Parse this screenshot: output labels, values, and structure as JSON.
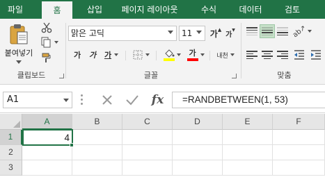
{
  "ribbon_tabs": [
    {
      "label": "파일",
      "active": false
    },
    {
      "label": "홈",
      "active": true
    },
    {
      "label": "삽입",
      "active": false
    },
    {
      "label": "페이지 레이아웃",
      "active": false
    },
    {
      "label": "수식",
      "active": false
    },
    {
      "label": "데이터",
      "active": false
    },
    {
      "label": "검토",
      "active": false
    }
  ],
  "clipboard": {
    "paste_label": "붙여넣기",
    "group_label": "클립보드"
  },
  "font": {
    "family": "맑은 고딕",
    "size": "11",
    "grow_label": "가",
    "shrink_label": "가",
    "bold_label": "가",
    "italic_label": "가",
    "underline_label": "가",
    "color_label": "가",
    "phonetic_label": "내천",
    "group_label": "글꼴"
  },
  "alignment": {
    "group_label": "맞춤"
  },
  "formula_bar": {
    "name_box": "A1",
    "formula": "=RANDBETWEEN(1, 53)",
    "fx_label": "fx"
  },
  "sheet": {
    "columns": [
      "A",
      "B",
      "C",
      "D",
      "E",
      "F"
    ],
    "rows": [
      "1",
      "2",
      "3"
    ],
    "cells": {
      "A1": "4"
    }
  },
  "colors": {
    "accent": "#217346",
    "fill_color": "#ffff00",
    "font_color": "#ff0000"
  }
}
